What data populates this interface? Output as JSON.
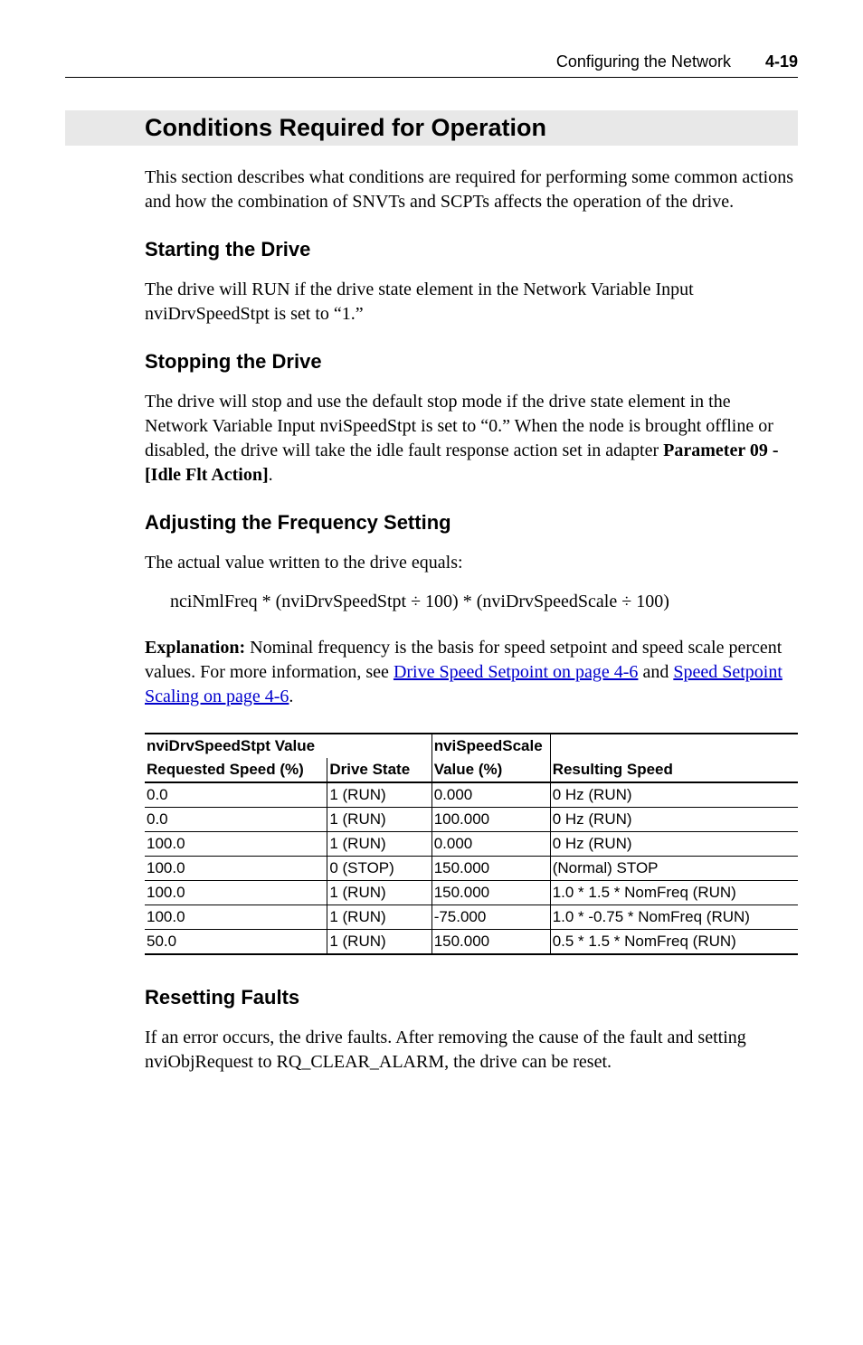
{
  "header": {
    "chapter": "Configuring the Network",
    "page_num": "4-19"
  },
  "h1": "Conditions Required for Operation",
  "intro": "This section describes what conditions are required for performing some common actions and how the combination of SNVTs and SCPTs affects the operation of the drive.",
  "sections": {
    "start": {
      "title": "Starting the Drive",
      "body": "The drive will RUN if the drive state element in the Network Variable Input nviDrvSpeedStpt is set to “1.”"
    },
    "stop": {
      "title": "Stopping the Drive",
      "body_pre": "The drive will stop and use the default stop mode if the drive state element in the Network Variable Input nviSpeedStpt is set to “0.” When the node is brought offline or disabled, the drive will take the idle fault response action set in adapter ",
      "body_bold": "Parameter 09 - [Idle Flt Action]",
      "body_post": "."
    },
    "adjust": {
      "title": "Adjusting the Frequency Setting",
      "lead": "The actual value written to the drive equals:",
      "formula": "nciNmlFreq * (nviDrvSpeedStpt ÷ 100) * (nviDrvSpeedScale ÷ 100)",
      "exp_label": "Explanation:",
      "exp_body_pre": " Nominal frequency is the basis for speed setpoint and speed scale percent values. For more information, see ",
      "exp_link1": "Drive Speed Setpoint on page 4-6",
      "exp_mid": " and ",
      "exp_link2": "Speed Setpoint Scaling on page 4-6",
      "exp_post": "."
    },
    "reset": {
      "title": "Resetting Faults",
      "body": "If an error occurs, the drive faults. After removing the cause of the fault and setting nviObjRequest to RQ_CLEAR_ALARM, the drive can be reset."
    }
  },
  "table": {
    "head": {
      "group1": "nviDrvSpeedStpt Value",
      "col1": "Requested Speed (%)",
      "col2": "Drive State",
      "col3a": "nviSpeedScale",
      "col3b": "Value (%)",
      "col4": "Resulting Speed"
    },
    "rows": [
      {
        "c1": "0.0",
        "c2": "1 (RUN)",
        "c3": "0.000",
        "c4": "0 Hz (RUN)"
      },
      {
        "c1": "0.0",
        "c2": "1 (RUN)",
        "c3": "100.000",
        "c4": "0 Hz (RUN)"
      },
      {
        "c1": "100.0",
        "c2": "1 (RUN)",
        "c3": "0.000",
        "c4": "0 Hz (RUN)"
      },
      {
        "c1": "100.0",
        "c2": "0 (STOP)",
        "c3": "150.000",
        "c4": "(Normal) STOP"
      },
      {
        "c1": "100.0",
        "c2": "1 (RUN)",
        "c3": "150.000",
        "c4": "1.0 * 1.5 * NomFreq (RUN)"
      },
      {
        "c1": "100.0",
        "c2": "1 (RUN)",
        "c3": "-75.000",
        "c4": "1.0 * -0.75 * NomFreq (RUN)"
      },
      {
        "c1": "50.0",
        "c2": "1 (RUN)",
        "c3": "150.000",
        "c4": "0.5 * 1.5 * NomFreq (RUN)"
      }
    ]
  }
}
